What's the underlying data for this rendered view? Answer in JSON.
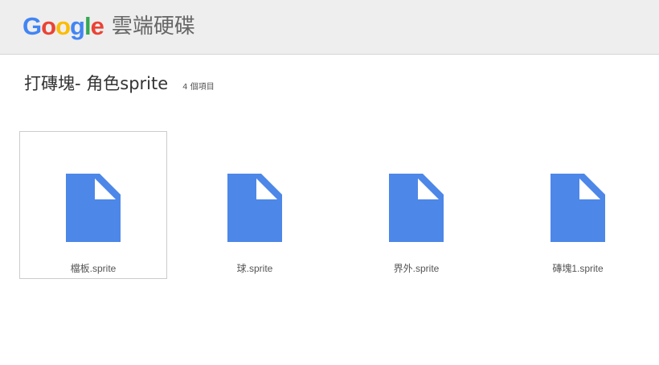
{
  "header": {
    "logo_letters": [
      {
        "char": "G",
        "color": "#4285F4"
      },
      {
        "char": "o",
        "color": "#EA4335"
      },
      {
        "char": "o",
        "color": "#FBBC05"
      },
      {
        "char": "g",
        "color": "#4285F4"
      },
      {
        "char": "l",
        "color": "#34A853"
      },
      {
        "char": "e",
        "color": "#EA4335"
      }
    ],
    "logo_text": "Google",
    "product_name": "雲端硬碟"
  },
  "folder": {
    "title": "打磚塊- 角色sprite",
    "item_count": "4 個項目"
  },
  "files": [
    {
      "name": "檔板.sprite",
      "icon": "document-icon",
      "selected": true
    },
    {
      "name": "球.sprite",
      "icon": "document-icon",
      "selected": false
    },
    {
      "name": "界外.sprite",
      "icon": "document-icon",
      "selected": false
    },
    {
      "name": "磚塊1.sprite",
      "icon": "document-icon",
      "selected": false
    }
  ],
  "colors": {
    "file_icon": "#4D87E8",
    "header_bg": "#EEEEEE"
  }
}
